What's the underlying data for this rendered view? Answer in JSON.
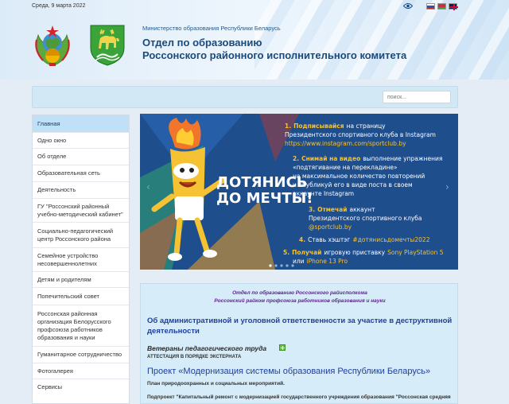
{
  "header": {
    "date": "Среда, 9 марта 2022",
    "ministry": "Министерство образования Республики Беларусь",
    "title_line1": "Отдел по образованию",
    "title_line2": "Россонского районного исполнительного комитета",
    "icons": [
      "eye-icon",
      "flag-ru-icon",
      "flag-by-icon",
      "flag-en-icon"
    ]
  },
  "search": {
    "placeholder": "поиск..."
  },
  "sidebar": {
    "items": [
      {
        "label": "Главная",
        "active": true
      },
      {
        "label": "Одно окно"
      },
      {
        "label": "Об отделе"
      },
      {
        "label": "Образовательная сеть"
      },
      {
        "label": "Деятельность"
      },
      {
        "label": "ГУ \"Россонский районный учебно-методический кабинет\""
      },
      {
        "label": "Социально-педагогический центр Россонского района"
      },
      {
        "label": "Семейное устройство несовершеннолетних"
      },
      {
        "label": "Детям и родителям"
      },
      {
        "label": "Попечительский совет"
      },
      {
        "label": "Россонская районная организация Белорусского профсоюза работников образования и науки"
      },
      {
        "label": "Гуманитарное сотрудничество"
      },
      {
        "label": "Фотогалерея"
      },
      {
        "label": "Сервисы"
      }
    ]
  },
  "banner": {
    "slogan_line1": "ДОТЯНИСЬ",
    "slogan_line2": "ДО МЕЧТЫ!",
    "step1_num": "1.",
    "step1_hl": "Подписывайся",
    "step1_rest": "на страницу",
    "step1_line2": "Президентского спортивного клуба в Instagram",
    "step1_url": "https://www.instagram.com/sportclub.by",
    "step2_num": "2.",
    "step2_hl": "Снимай на видео",
    "step2_rest": "выполнение упражнения",
    "step2_line2": "«подтягивание на перекладине»",
    "step2_line3": "на максимальное количество повторений",
    "step2_line4": "и опубликуй его в виде поста в своем",
    "step2_line5": "аккаунте Instagram",
    "step3_num": "3.",
    "step3_hl": "Отмечай",
    "step3_rest": "аккаунт",
    "step3_line2": "Президентского спортивного клуба",
    "step3_line3": "@sportclub.by",
    "step4_num": "4.",
    "step4_rest": "Ставь хэштэг",
    "step4_hl": "#дотянисьдомечты2022",
    "step5_num": "5.",
    "step5_hl": "Получай",
    "step5_rest": "игровую приставку",
    "step5_prize1": "Sony PlayStation 5",
    "step5_or": "или",
    "step5_prize2": "iPhone 13 Pro",
    "colors": {
      "bg": "#1f4e8d",
      "accent": "#f5c233",
      "text": "#ffffff"
    }
  },
  "content": {
    "italic1": "Отдел по образованию Россонского райисполкома",
    "italic2": "Россонский райком профсоюза работников образования и науки",
    "headline": "Об административной и уголовной ответственности за участие в деструктивной деятельности",
    "veterans": "Ветераны педагогического труда",
    "attestation": "АТТЕСТАЦИЯ В ПОРЯДКЕ ЭКСТЕРНАТА",
    "project": "Проект «Модернизация системы образования Республики Беларусь»",
    "plan": "План природоохранных и социальных мероприятий.",
    "subproject": "Подпроект \"Капитальный ремонт с модернизацией государственного учреждения образования \"Россонская средняя"
  }
}
